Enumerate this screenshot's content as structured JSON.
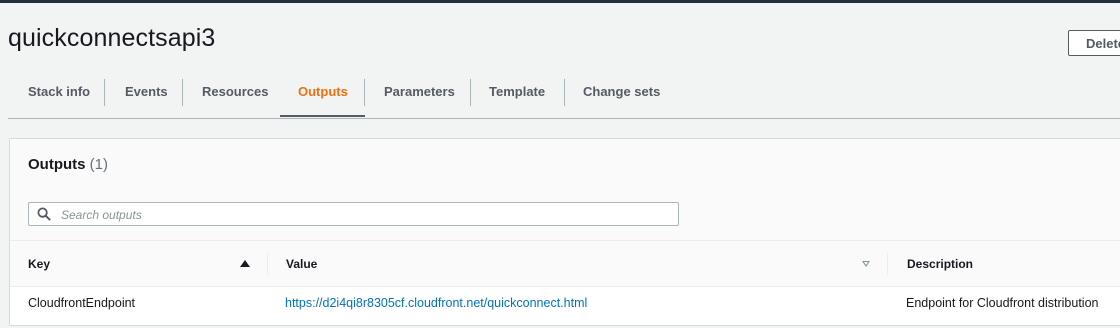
{
  "stack": {
    "name": "quickconnectsapi3",
    "delete_label": "Delete"
  },
  "tabs": [
    {
      "label": "Stack info"
    },
    {
      "label": "Events"
    },
    {
      "label": "Resources"
    },
    {
      "label": "Outputs",
      "active": true
    },
    {
      "label": "Parameters"
    },
    {
      "label": "Template"
    },
    {
      "label": "Change sets"
    }
  ],
  "outputs": {
    "title": "Outputs",
    "count": "(1)",
    "search_placeholder": "Search outputs",
    "columns": {
      "key": "Key",
      "value": "Value",
      "description": "Description"
    },
    "rows": [
      {
        "key": "CloudfrontEndpoint",
        "value": "https://d2i4qi8r8305cf.cloudfront.net/quickconnect.html",
        "description": "Endpoint for Cloudfront distribution"
      }
    ]
  },
  "colors": {
    "accent": "#ec7211",
    "link": "#0073bb",
    "tab_text": "#545b64"
  }
}
